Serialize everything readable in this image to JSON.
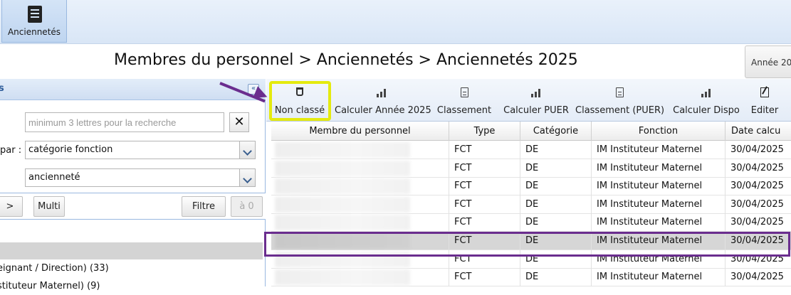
{
  "topbar": {
    "anciennetes_label": "Anciennetés"
  },
  "page": {
    "title": "Membres du personnel > Anciennetés > Anciennetés 2025",
    "year_button": "Année 20"
  },
  "left_panel": {
    "header": "s",
    "search_placeholder": "minimum 3 lettres pour la recherche",
    "par_label": "par :",
    "select_group": "catégorie fonction",
    "select_sort": "ancienneté",
    "buttons": {
      "next": ">",
      "multi": "Multi",
      "filtre": "Filtre",
      "count": "à 0"
    },
    "tree": [
      {
        "label": ")",
        "selected": true
      },
      {
        "label": "eignant / Direction) (33)",
        "selected": false
      },
      {
        "label": "stituteur Maternel) (9)",
        "selected": false
      }
    ]
  },
  "toolbar": {
    "buttons": [
      {
        "label": "Non classé",
        "icon": "filter-icon"
      },
      {
        "label": "Calculer Année 2025",
        "icon": "bars-icon"
      },
      {
        "label": "Classement",
        "icon": "document-icon"
      },
      {
        "label": "Calculer PUER",
        "icon": "bars-icon"
      },
      {
        "label": "Classement (PUER)",
        "icon": "document-icon"
      },
      {
        "label": "Calculer Dispo",
        "icon": "bars-icon"
      },
      {
        "label": "Editer",
        "icon": "edit-icon"
      }
    ]
  },
  "grid": {
    "headers": [
      "Membre du personnel",
      "Type",
      "Catégorie",
      "Fonction",
      "Date calcu"
    ],
    "rows": [
      {
        "type": "FCT",
        "categorie": "DE",
        "fonction": "IM Instituteur Maternel",
        "date": "30/04/2025"
      },
      {
        "type": "FCT",
        "categorie": "DE",
        "fonction": "IM Instituteur Maternel",
        "date": "30/04/2025"
      },
      {
        "type": "FCT",
        "categorie": "DE",
        "fonction": "IM Instituteur Maternel",
        "date": "30/04/2025"
      },
      {
        "type": "FCT",
        "categorie": "DE",
        "fonction": "IM Instituteur Maternel",
        "date": "30/04/2025"
      },
      {
        "type": "FCT",
        "categorie": "DE",
        "fonction": "IM Instituteur Maternel",
        "date": "30/04/2025"
      },
      {
        "type": "FCT",
        "categorie": "DE",
        "fonction": "IM Instituteur Maternel",
        "date": "30/04/2025"
      },
      {
        "type": "FCT",
        "categorie": "DE",
        "fonction": "IM Instituteur Maternel",
        "date": "30/04/2025"
      },
      {
        "type": "FCT",
        "categorie": "DE",
        "fonction": "IM Instituteur Maternel",
        "date": "30/04/2025"
      }
    ],
    "selected_row": 5
  },
  "colors": {
    "highlight_yellow": "#e4ea0f",
    "annotation_purple": "#6a2d8e",
    "panel_blue": "#2f5d9a"
  }
}
